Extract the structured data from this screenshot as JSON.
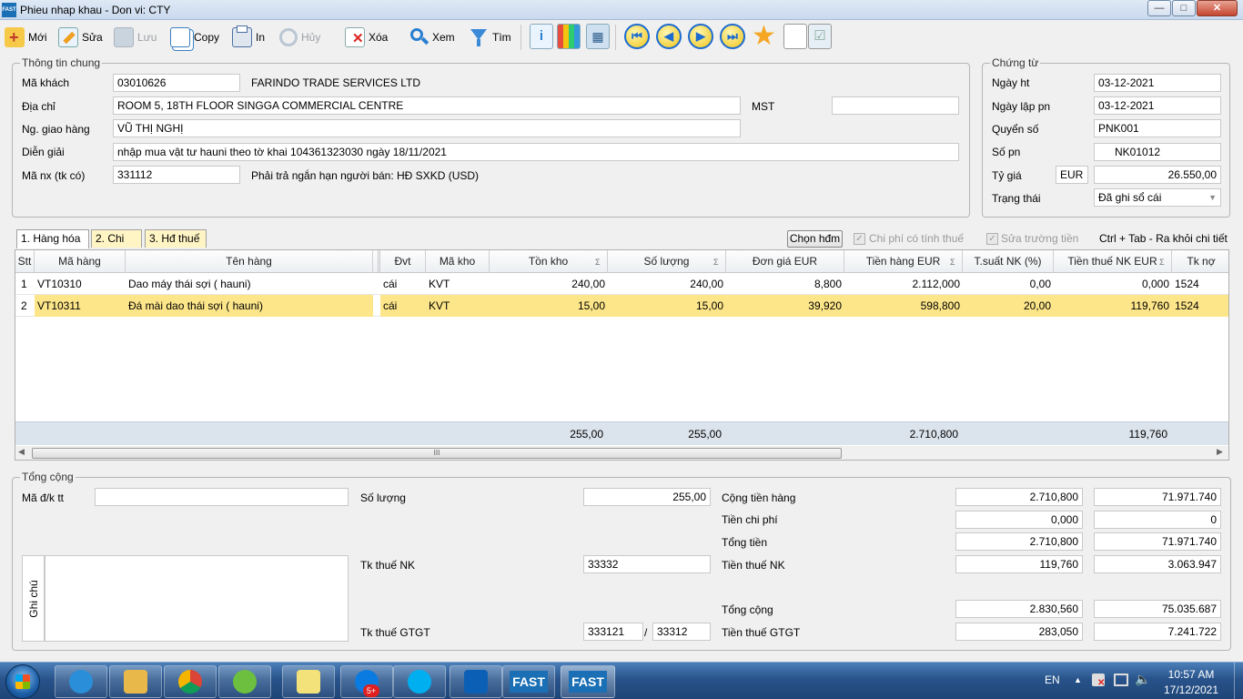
{
  "window": {
    "title": "Phieu nhap khau - Don vi: CTY",
    "app_badge": "FAST",
    "min": "—",
    "max": "□",
    "close": "✕"
  },
  "toolbar": {
    "new": "Mới",
    "edit": "Sửa",
    "save": "Lưu",
    "copy": "Copy",
    "print": "In",
    "undo": "Hủy",
    "delete": "Xóa",
    "view": "Xem",
    "find": "Tìm"
  },
  "general": {
    "legend": "Thông tin chung",
    "customer_code_label": "Mã khách",
    "customer_code": "03010626",
    "customer_name": "FARINDO TRADE SERVICES LTD",
    "address_label": "Địa chỉ",
    "address": "ROOM 5, 18TH FLOOR SINGGA COMMERCIAL CENTRE",
    "tax_code_label": "MST",
    "tax_code": "",
    "deliverer_label": "Ng. giao hàng",
    "deliverer": "VŨ THỊ NGHỊ",
    "description_label": "Diễn giải",
    "description": "nhập mua vật tư hauni  theo tờ khai 104361323030 ngày 18/11/2021",
    "account_label": "Mã nx (tk có)",
    "account": "331112",
    "account_desc": "Phải trả ngắn hạn người bán: HĐ SXKD (USD)"
  },
  "voucher": {
    "legend": "Chứng từ",
    "posting_date_label": "Ngày ht",
    "posting_date": "03-12-2021",
    "doc_date_label": "Ngày lập pn",
    "doc_date": "03-12-2021",
    "book_label": "Quyển số",
    "book": "PNK001",
    "number_label": "Số pn",
    "number": "NK01012",
    "rate_label": "Tỷ giá",
    "currency": "EUR",
    "rate": "26.550,00",
    "status_label": "Trạng thái",
    "status": "Đã ghi sổ cái"
  },
  "tabs": [
    "1. Hàng hóa",
    "2. Chi phí",
    "3. Hđ thuế"
  ],
  "grid_options": {
    "choose_invoice": "Chọn hđm",
    "cost_with_tax": "Chi phí có tính thuế",
    "edit_amount": "Sửa trường tiền",
    "hint": "Ctrl + Tab - Ra khỏi chi tiết"
  },
  "grid": {
    "columns": [
      "Stt",
      "Mã hàng",
      "Tên hàng",
      "Đvt",
      "Mã kho",
      "Tồn kho",
      "Số lượng",
      "Đơn giá EUR",
      "Tiền hàng EUR",
      "T.suất NK (%)",
      "Tiền thuế NK EUR",
      "Tk nợ"
    ],
    "sum_mark": "Σ",
    "rows": [
      {
        "stt": "1",
        "code": "VT10310",
        "name": "Dao máy thái sợi ( hauni)",
        "unit": "cái",
        "wh": "KVT",
        "stock": "240,00",
        "qty": "240,00",
        "price": "8,800",
        "amount": "2.112,000",
        "rate": "0,00",
        "tax": "0,000",
        "acct": "1524"
      },
      {
        "stt": "2",
        "code": "VT10311",
        "name": "Đá mài dao thái sợi ( hauni)",
        "unit": "cái",
        "wh": "KVT",
        "stock": "15,00",
        "qty": "15,00",
        "price": "39,920",
        "amount": "598,800",
        "rate": "20,00",
        "tax": "119,760",
        "acct": "1524"
      }
    ],
    "totals": {
      "stock": "255,00",
      "qty": "255,00",
      "amount": "2.710,800",
      "tax": "119,760"
    },
    "scroll_grip": "III"
  },
  "summary": {
    "legend": "Tổng cộng",
    "payment_label": "Mã đ/k tt",
    "payment": "",
    "notes_label": "Ghi chú",
    "qty_label": "Số lượng",
    "qty": "255,00",
    "import_tax_acct_label": "Tk thuế NK",
    "import_tax_acct": "33332",
    "vat_acct_label": "Tk thuế GTGT",
    "vat_acct_1": "333121",
    "vat_acct_sep": "/",
    "vat_acct_2": "33312",
    "goods_total_label": "Cộng tiền hàng",
    "goods_total_fc": "2.710,800",
    "goods_total_vnd": "71.971.740",
    "cost_label": "Tiền chi phí",
    "cost_fc": "0,000",
    "cost_vnd": "0",
    "amount_label": "Tổng tiền",
    "amount_fc": "2.710,800",
    "amount_vnd": "71.971.740",
    "import_tax_label": "Tiền thuế NK",
    "import_tax_fc": "119,760",
    "import_tax_vnd": "3.063.947",
    "grand_total_label": "Tổng cộng",
    "grand_total_fc": "2.830,560",
    "grand_total_vnd": "75.035.687",
    "vat_label": "Tiền thuế GTGT",
    "vat_fc": "283,050",
    "vat_vnd": "7.241.722"
  },
  "taskbar": {
    "apps": [
      {
        "name": "internet-explorer-icon",
        "color": "#2a8fd8"
      },
      {
        "name": "file-explorer-icon",
        "color": "#e8b84a"
      },
      {
        "name": "chrome-icon",
        "color": "#dd4b39"
      },
      {
        "name": "coccoc-icon",
        "color": "#6cbf3f"
      },
      {
        "name": "sticky-notes-icon",
        "color": "#f3e27a"
      },
      {
        "name": "zalo-icon",
        "color": "#0a7be0"
      },
      {
        "name": "skype-icon",
        "color": "#00aff0"
      },
      {
        "name": "outlook-icon",
        "color": "#0b5fb5"
      }
    ],
    "zalo_badge": "5+",
    "fast1": "FAST",
    "fast2": "FAST",
    "lang": "EN",
    "time": "10:57 AM",
    "date": "17/12/2021"
  }
}
